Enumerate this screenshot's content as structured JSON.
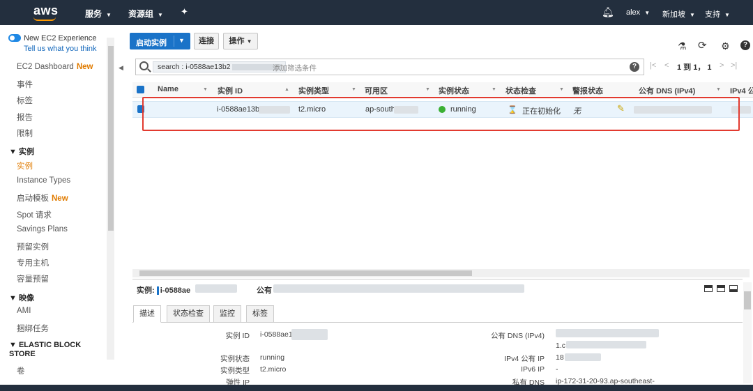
{
  "topbar": {
    "logo": "aws",
    "services": "服务",
    "resource_groups": "资源组",
    "user": "alex",
    "region": "新加坡",
    "support": "支持"
  },
  "sidebar": {
    "experience_title": "New EC2 Experience",
    "experience_link": "Tell us what you think",
    "new_tag": "New",
    "dashboard": "EC2 Dashboard",
    "events": "事件",
    "tags": "标签",
    "reports": "报告",
    "limits": "限制",
    "section_instances": "实例",
    "instances": "实例",
    "instance_types": "Instance Types",
    "launch_templates": "启动模板",
    "spot": "Spot 请求",
    "savings_plans": "Savings Plans",
    "reserved": "预留实例",
    "dedicated_hosts": "专用主机",
    "capacity": "容量预留",
    "section_images": "映像",
    "ami": "AMI",
    "bundle_tasks": "捆绑任务",
    "section_ebs": "ELASTIC BLOCK STORE",
    "volumes": "卷"
  },
  "toolbar": {
    "launch": "启动实例",
    "connect": "连接",
    "actions": "操作"
  },
  "search": {
    "token": "search : i-0588ae13b2",
    "placeholder": "添加筛选条件"
  },
  "pager": {
    "text": "1 到 1， 1"
  },
  "table": {
    "columns": [
      "Name",
      "实例 ID",
      "实例类型",
      "可用区",
      "实例状态",
      "状态检查",
      "警报状态",
      "公有 DNS (IPv4)",
      "IPv4 公"
    ],
    "row": {
      "instance_id": "i-0588ae13b2",
      "type": "t2.micro",
      "az": "ap-south",
      "state": "running",
      "status_check": "正在初始化",
      "alarm": "无"
    }
  },
  "detail": {
    "title_label": "实例:",
    "instance_id": "i-0588ae",
    "public_label": "公有",
    "tabs": [
      "描述",
      "状态检查",
      "监控",
      "标签"
    ],
    "left": [
      {
        "label": "实例 ID",
        "value": "i-0588ae1"
      },
      {
        "label": "实例状态",
        "value": "running"
      },
      {
        "label": "实例类型",
        "value": "t2.micro"
      },
      {
        "label": "弹性 IP",
        "value": ""
      }
    ],
    "right": [
      {
        "label": "公有 DNS (IPv4)",
        "value": "1.c"
      },
      {
        "label": "IPv4 公有 IP",
        "value": "18"
      },
      {
        "label": "IPv6 IP",
        "value": "-"
      },
      {
        "label": "私有 DNS",
        "value": "ip-172-31-20-93.ap-southeast-"
      }
    ]
  }
}
